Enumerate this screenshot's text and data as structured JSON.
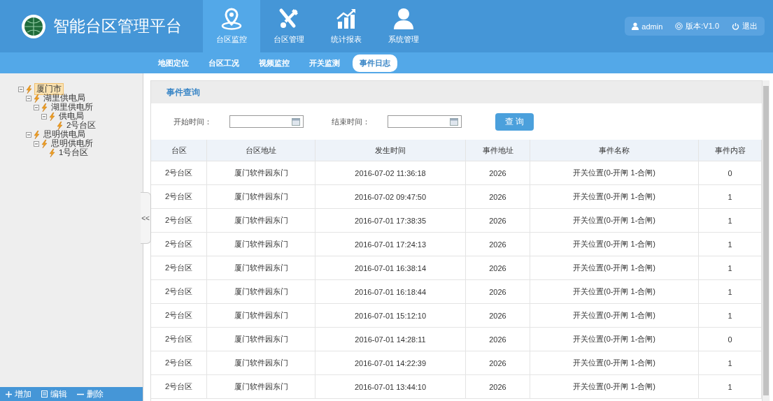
{
  "header": {
    "title": "智能台区管理平台",
    "nav": [
      {
        "kind": "pin",
        "label": "台区监控",
        "selected": true
      },
      {
        "kind": "tools",
        "label": "台区管理",
        "selected": false
      },
      {
        "kind": "chart",
        "label": "统计报表",
        "selected": false
      },
      {
        "kind": "user",
        "label": "系统管理",
        "selected": false
      }
    ],
    "user": "admin",
    "version": "版本:V1.0",
    "logout": "退出"
  },
  "subnav": [
    {
      "label": "地图定位",
      "selected": false
    },
    {
      "label": "台区工况",
      "selected": false
    },
    {
      "label": "视频监控",
      "selected": false
    },
    {
      "label": "开关监测",
      "selected": false
    },
    {
      "label": "事件日志",
      "selected": true
    }
  ],
  "sidebar": {
    "tree": [
      {
        "label": "厦门市",
        "selected": true,
        "expanded": true,
        "children": [
          {
            "label": "湖里供电局",
            "selected": false,
            "expanded": true,
            "children": [
              {
                "label": "湖里供电所",
                "selected": false,
                "expanded": true,
                "children": [
                  {
                    "label": "供电局",
                    "selected": false,
                    "expanded": true,
                    "children": [
                      {
                        "label": "2号台区",
                        "selected": false
                      }
                    ]
                  }
                ]
              }
            ]
          },
          {
            "label": "思明供电局",
            "selected": false,
            "expanded": true,
            "children": [
              {
                "label": "思明供电所",
                "selected": false,
                "expanded": true,
                "children": [
                  {
                    "label": "1号台区",
                    "selected": false
                  }
                ]
              }
            ]
          }
        ]
      }
    ],
    "collapse": "<<",
    "actions": [
      {
        "kind": "add",
        "label": "增加"
      },
      {
        "kind": "edit",
        "label": "编辑"
      },
      {
        "kind": "delete",
        "label": "删除"
      }
    ]
  },
  "panel": {
    "title": "事件查询",
    "start_label": "开始时间：",
    "end_label": "结束时间：",
    "query_button": "查 询",
    "table": {
      "columns": [
        "台区",
        "台区地址",
        "发生时间",
        "事件地址",
        "事件名称",
        "事件内容"
      ],
      "rows": [
        [
          "2号台区",
          "厦门软件园东门",
          "2016-07-02 11:36:18",
          "2026",
          "开关位置(0-开闸 1-合闸)",
          "0"
        ],
        [
          "2号台区",
          "厦门软件园东门",
          "2016-07-02 09:47:50",
          "2026",
          "开关位置(0-开闸 1-合闸)",
          "1"
        ],
        [
          "2号台区",
          "厦门软件园东门",
          "2016-07-01 17:38:35",
          "2026",
          "开关位置(0-开闸 1-合闸)",
          "1"
        ],
        [
          "2号台区",
          "厦门软件园东门",
          "2016-07-01 17:24:13",
          "2026",
          "开关位置(0-开闸 1-合闸)",
          "1"
        ],
        [
          "2号台区",
          "厦门软件园东门",
          "2016-07-01 16:38:14",
          "2026",
          "开关位置(0-开闸 1-合闸)",
          "1"
        ],
        [
          "2号台区",
          "厦门软件园东门",
          "2016-07-01 16:18:44",
          "2026",
          "开关位置(0-开闸 1-合闸)",
          "1"
        ],
        [
          "2号台区",
          "厦门软件园东门",
          "2016-07-01 15:12:10",
          "2026",
          "开关位置(0-开闸 1-合闸)",
          "1"
        ],
        [
          "2号台区",
          "厦门软件园东门",
          "2016-07-01 14:28:11",
          "2026",
          "开关位置(0-开闸 1-合闸)",
          "0"
        ],
        [
          "2号台区",
          "厦门软件园东门",
          "2016-07-01 14:22:39",
          "2026",
          "开关位置(0-开闸 1-合闸)",
          "1"
        ],
        [
          "2号台区",
          "厦门软件园东门",
          "2016-07-01 13:44:10",
          "2026",
          "开关位置(0-开闸 1-合闸)",
          "1"
        ]
      ]
    }
  }
}
